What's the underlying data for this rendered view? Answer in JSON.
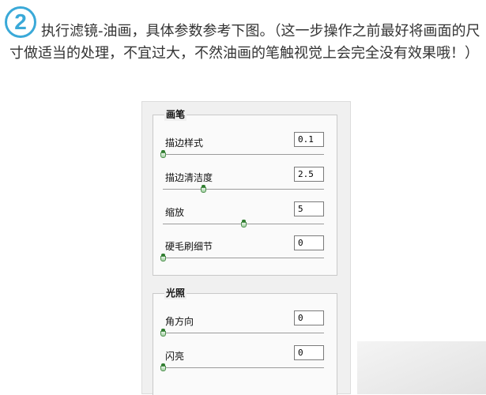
{
  "step": {
    "number": "2"
  },
  "intro_text": "执行滤镜-油画，具体参数参考下图。（这一步操作之前最好将画面的尺寸做适当的处理，不宜过大，不然油画的笔触视觉上会完全没有效果哦！）",
  "dialog": {
    "brush_group": {
      "title": "画笔",
      "params": [
        {
          "label": "描边样式",
          "value": "0.1",
          "fraction": 0.0
        },
        {
          "label": "描边清洁度",
          "value": "2.5",
          "fraction": 0.25
        },
        {
          "label": "缩放",
          "value": "5",
          "fraction": 0.5
        },
        {
          "label": "硬毛刷细节",
          "value": "0",
          "fraction": 0.0
        }
      ]
    },
    "lighting_group": {
      "title": "光照",
      "params": [
        {
          "label": "角方向",
          "value": "0",
          "fraction": 0.0
        },
        {
          "label": "闪亮",
          "value": "0",
          "fraction": 0.0
        }
      ]
    }
  },
  "colors": {
    "accent": "#3aa9d8",
    "slider_thumb": "#4e8f4e"
  },
  "icons": {
    "step_badge": "circled-digit-icon",
    "slider_thumb": "slider-thumb-icon"
  }
}
